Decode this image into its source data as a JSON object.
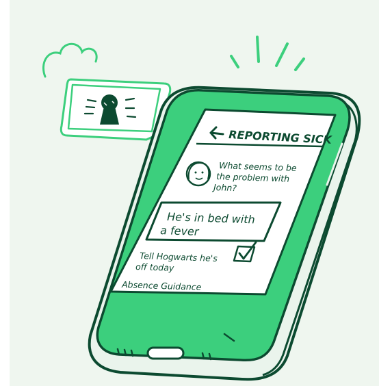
{
  "screen": {
    "title": "REPORTING SICK",
    "question_line1": "What seems to be",
    "question_line2": "the problem with",
    "question_line3": "John?",
    "answer_line1": "He's in bed with",
    "answer_line2": "a fever",
    "action_line1": "Tell Hogwarts he's",
    "action_line2": "off today",
    "guidance_link": "Absence Guidance"
  },
  "colors": {
    "dark_green": "#0c4a30",
    "bright_green": "#3ccf7d",
    "background": "#eff6ef",
    "screen": "#ffffff"
  },
  "icons": [
    "back-arrow-icon",
    "avatar-icon",
    "checkbox-icon",
    "keyhole-icon",
    "chat-bubble-icon",
    "sparkle-lines-icon",
    "charging-port-icon",
    "speaker-grille-icon"
  ]
}
